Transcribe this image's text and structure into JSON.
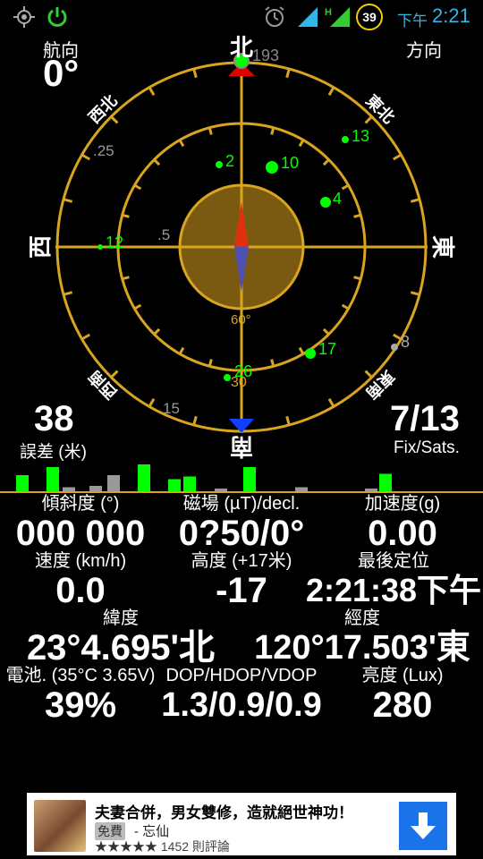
{
  "status_bar": {
    "icons": [
      "gps-icon",
      "power-icon",
      "alarm-icon",
      "signal-icon",
      "signal-h-icon",
      "battery-icon"
    ],
    "battery_badge": "39",
    "network_type": "H",
    "time_ampm": "下午",
    "time": "2:21",
    "accent_color": "#33b5e5"
  },
  "heading": {
    "label": "航向",
    "value": "0°"
  },
  "direction": {
    "label": "方向"
  },
  "compass": {
    "north": "北",
    "south": "南",
    "east": "東",
    "west": "西",
    "northeast": "東北",
    "northwest": "西北",
    "southeast": "東南",
    "southwest": "西南",
    "ring_labels": [
      ".25",
      ".5",
      "15",
      "30",
      "60°"
    ],
    "top_sat_label": "193",
    "ring_color": "#d9a520",
    "sat_color": "#00ff00",
    "satellites": [
      {
        "id": "2"
      },
      {
        "id": "10"
      },
      {
        "id": "13"
      },
      {
        "id": "4"
      },
      {
        "id": "12"
      },
      {
        "id": "17"
      },
      {
        "id": "26"
      },
      {
        "id": "8"
      }
    ]
  },
  "error": {
    "value": "38",
    "label": "誤差 (米)"
  },
  "fix": {
    "value": "7/13",
    "label": "Fix/Sats."
  },
  "signal_bars": {
    "levels": [
      0.6,
      0.9,
      0.15,
      0.2,
      0.6,
      1.0,
      0.45,
      0.55,
      0.1,
      0.9,
      0.15,
      0.1,
      0.65
    ],
    "states": [
      "used",
      "used",
      "gray",
      "gray",
      "gray",
      "used",
      "used",
      "used",
      "gray",
      "used",
      "gray",
      "gray",
      "used"
    ]
  },
  "metrics": {
    "tilt": {
      "label": "傾斜度 (°)",
      "value": "000 000"
    },
    "magnetic": {
      "label": "磁場 (µT)/decl.",
      "value": "0?50/0°"
    },
    "accel": {
      "label": "加速度(g)",
      "value": "0.00"
    },
    "speed": {
      "label": "速度 (km/h)",
      "value": "0.0"
    },
    "altitude": {
      "label": "高度 (+17米)",
      "value": "-17"
    },
    "last_fix": {
      "label": "最後定位",
      "value": "2:21:38下午"
    },
    "latitude": {
      "label": "緯度",
      "value": "23°4.695'北"
    },
    "longitude": {
      "label": "經度",
      "value": "120°17.503'東"
    },
    "battery": {
      "label": "電池. (35°C 3.65V)",
      "value": "39%"
    },
    "dop": {
      "label": "DOP/HDOP/VDOP",
      "value": "1.3/0.9/0.9"
    },
    "brightness": {
      "label": "亮度 (Lux)",
      "value": "280"
    }
  },
  "ad": {
    "title": "夫妻合併，男女雙修，造就絕世神功！",
    "free_badge": "免費",
    "developer": "- 忘仙",
    "stars": "★★★★★",
    "reviews": "1452 則評論",
    "button_icon": "download-arrow-icon"
  }
}
